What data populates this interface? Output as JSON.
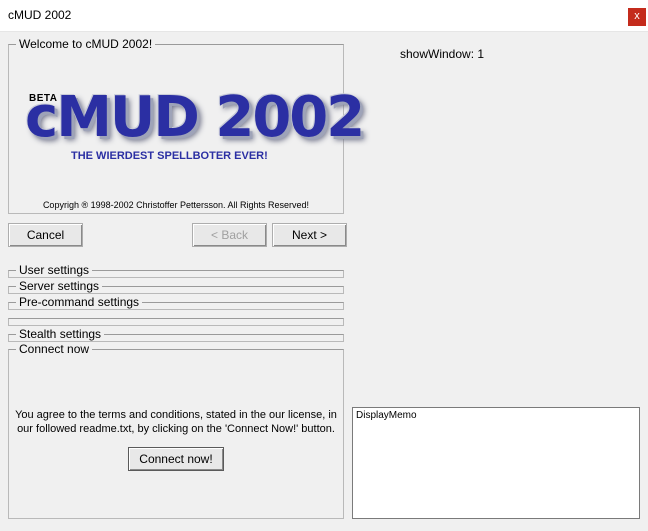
{
  "window": {
    "title": "cMUD 2002",
    "close_label": "x"
  },
  "welcome": {
    "group_label": "Welcome to cMUD 2002!",
    "logo_beta": "BETA",
    "logo_title": "cMUD 2002",
    "logo_subtitle": "THE WIERDEST SPELLBOTER EVER!",
    "copyright": "Copyrigh ® 1998-2002 Christoffer Pettersson. All Rights Reserved!"
  },
  "nav": {
    "cancel_label": "Cancel",
    "back_label": "< Back",
    "next_label": "Next >"
  },
  "sections": {
    "user_settings": "User settings",
    "server_settings": "Server settings",
    "precommand_settings": "Pre-command settings",
    "stealth_settings": "Stealth settings",
    "connect_now": "Connect now"
  },
  "connect": {
    "terms_line1": "You agree to the terms and conditions, stated in the our license, in",
    "terms_line2": "our followed readme.txt, by clicking on the 'Connect Now!' button.",
    "button_label": "Connect now!"
  },
  "status": {
    "show_window": "showWindow: 1"
  },
  "memo": {
    "text": "DisplayMemo"
  },
  "colors": {
    "logo_blue": "#2b2fa3",
    "close_red": "#c42b1c"
  }
}
